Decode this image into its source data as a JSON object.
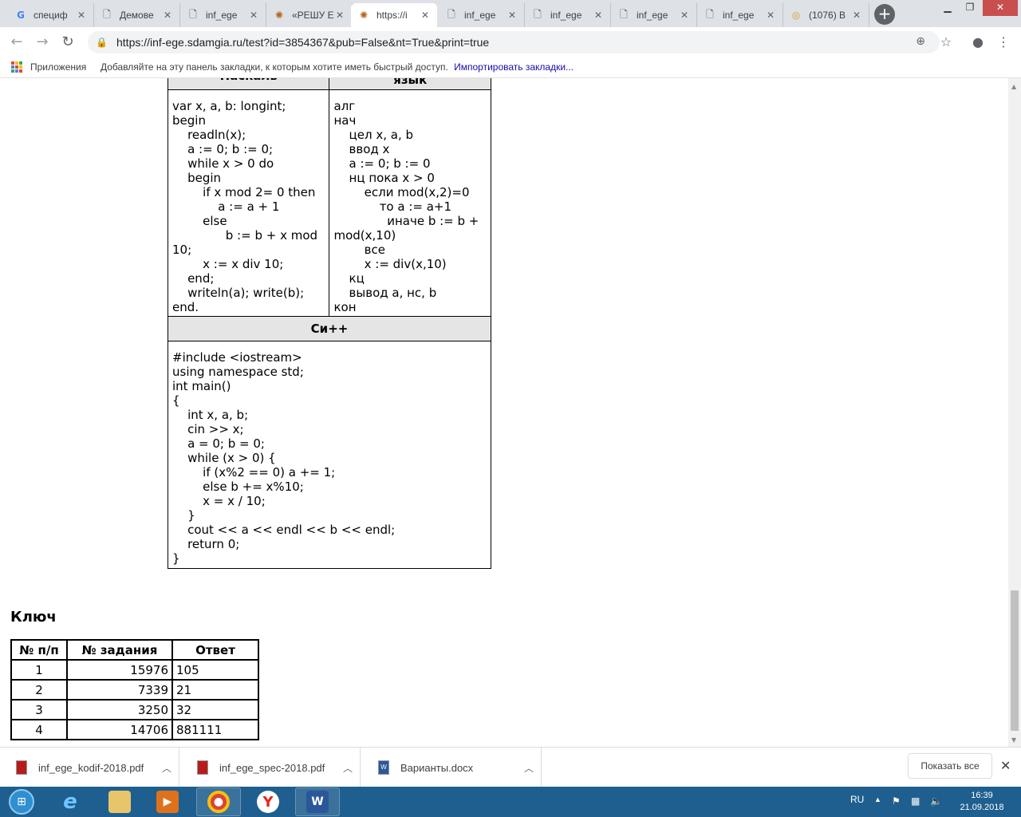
{
  "browser": {
    "tabs": [
      {
        "title": "специф",
        "icon": "google-icon"
      },
      {
        "title": "Демове",
        "icon": "page-icon"
      },
      {
        "title": "inf_ege",
        "icon": "page-icon"
      },
      {
        "title": "«РЕШУ Е",
        "icon": "sdamgia-icon"
      },
      {
        "title": "https://i",
        "icon": "sdamgia-icon",
        "active": true
      },
      {
        "title": "inf_ege",
        "icon": "page-icon"
      },
      {
        "title": "inf_ege",
        "icon": "page-icon"
      },
      {
        "title": "inf_ege",
        "icon": "page-icon"
      },
      {
        "title": "inf_ege",
        "icon": "page-icon"
      },
      {
        "title": "(1076) В",
        "icon": "site-icon"
      }
    ],
    "url": "https://inf-ege.sdamgia.ru/test?id=3854367&pub=False&nt=True&print=true",
    "bookmarks": {
      "apps_label": "Приложения",
      "hint": "Добавляйте на эту панель закладки, к которым хотите иметь быстрый доступ.",
      "import_link": "Импортировать закладки..."
    }
  },
  "page": {
    "col1_header": "Паскаль",
    "col2_header": "язык",
    "pascal_code": "var x, a, b: longint;\nbegin\n    readln(x);\n    a := 0; b := 0;\n    while x > 0 do\n    begin\n        if x mod 2= 0 then\n            a := a + 1\n        else\n              b := b + x mod 10;\n        x := x div 10;\n    end;\n    writeln(a); write(b);\nend.",
    "algo_code": "алг\nнач\n    цел x, a, b\n    ввод x\n    a := 0; b := 0\n    нц пока x > 0\n        если mod(x,2)=0\n            то a := a+1\n              иначе b := b + mod(x,10)\n        все\n        x := div(x,10)\n    кц\n    вывод a, нс, b\nкон",
    "cpp_header": "Си++",
    "cpp_code": "#include <iostream>\nusing namespace std;\nint main()\n{\n    int x, a, b;\n    cin >> x;\n    a = 0; b = 0;\n    while (x > 0) {\n        if (x%2 == 0) a += 1;\n        else b += x%10;\n        x = x / 10;\n    }\n    cout << a << endl << b << endl;\n    return 0;\n}",
    "key_title": "Ключ",
    "key_table": {
      "headers": [
        "№ п/п",
        "№ задания",
        "Ответ"
      ],
      "rows": [
        [
          "1",
          "15976",
          "105"
        ],
        [
          "2",
          "7339",
          "21"
        ],
        [
          "3",
          "3250",
          "32"
        ],
        [
          "4",
          "14706",
          "881111"
        ]
      ]
    }
  },
  "downloads": {
    "items": [
      {
        "name": "inf_ege_kodif-2018.pdf",
        "icon": "pdf-icon"
      },
      {
        "name": "inf_ege_spec-2018.pdf",
        "icon": "pdf-icon"
      },
      {
        "name": "Варианты.docx",
        "icon": "word-doc-icon"
      }
    ],
    "show_all": "Показать все"
  },
  "taskbar": {
    "lang": "RU",
    "time": "16:39",
    "date": "21.09.2018"
  }
}
